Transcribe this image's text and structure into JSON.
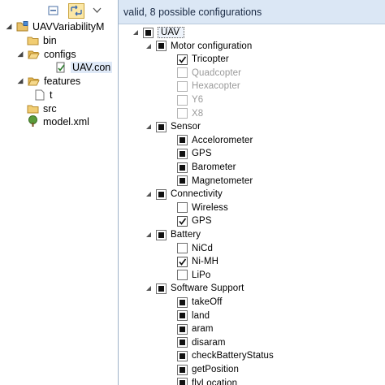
{
  "status": {
    "text": "valid, 8 possible configurations"
  },
  "explorer": {
    "project": "UAVVariabilityM",
    "items": [
      {
        "label": "bin"
      },
      {
        "label": "configs"
      },
      {
        "label": "UAV.con"
      },
      {
        "label": "features"
      },
      {
        "label": "t"
      },
      {
        "label": "src"
      },
      {
        "label": "model.xml"
      }
    ]
  },
  "config": {
    "root": "UAV",
    "groups": [
      {
        "label": "Motor configuration",
        "children": [
          {
            "label": "Tricopter",
            "state": "checked"
          },
          {
            "label": "Quadcopter",
            "state": "disabled"
          },
          {
            "label": "Hexacopter",
            "state": "disabled"
          },
          {
            "label": "Y6",
            "state": "disabled"
          },
          {
            "label": "X8",
            "state": "disabled"
          }
        ]
      },
      {
        "label": "Sensor",
        "children": [
          {
            "label": "Accelorometer",
            "state": "filled"
          },
          {
            "label": "GPS",
            "state": "filled"
          },
          {
            "label": "Barometer",
            "state": "filled"
          },
          {
            "label": "Magnetometer",
            "state": "filled"
          }
        ]
      },
      {
        "label": "Connectivity",
        "children": [
          {
            "label": "Wireless",
            "state": "empty"
          },
          {
            "label": "GPS",
            "state": "checked"
          }
        ]
      },
      {
        "label": "Battery",
        "children": [
          {
            "label": "NiCd",
            "state": "empty"
          },
          {
            "label": "Ni-MH",
            "state": "checked"
          },
          {
            "label": "LiPo",
            "state": "empty"
          }
        ]
      },
      {
        "label": "Software Support",
        "children": [
          {
            "label": "takeOff",
            "state": "filled"
          },
          {
            "label": "land",
            "state": "filled"
          },
          {
            "label": "aram",
            "state": "filled"
          },
          {
            "label": "disaram",
            "state": "filled"
          },
          {
            "label": "checkBatteryStatus",
            "state": "filled"
          },
          {
            "label": "getPosition",
            "state": "filled"
          },
          {
            "label": "flyLocation",
            "state": "filled"
          }
        ]
      }
    ]
  }
}
